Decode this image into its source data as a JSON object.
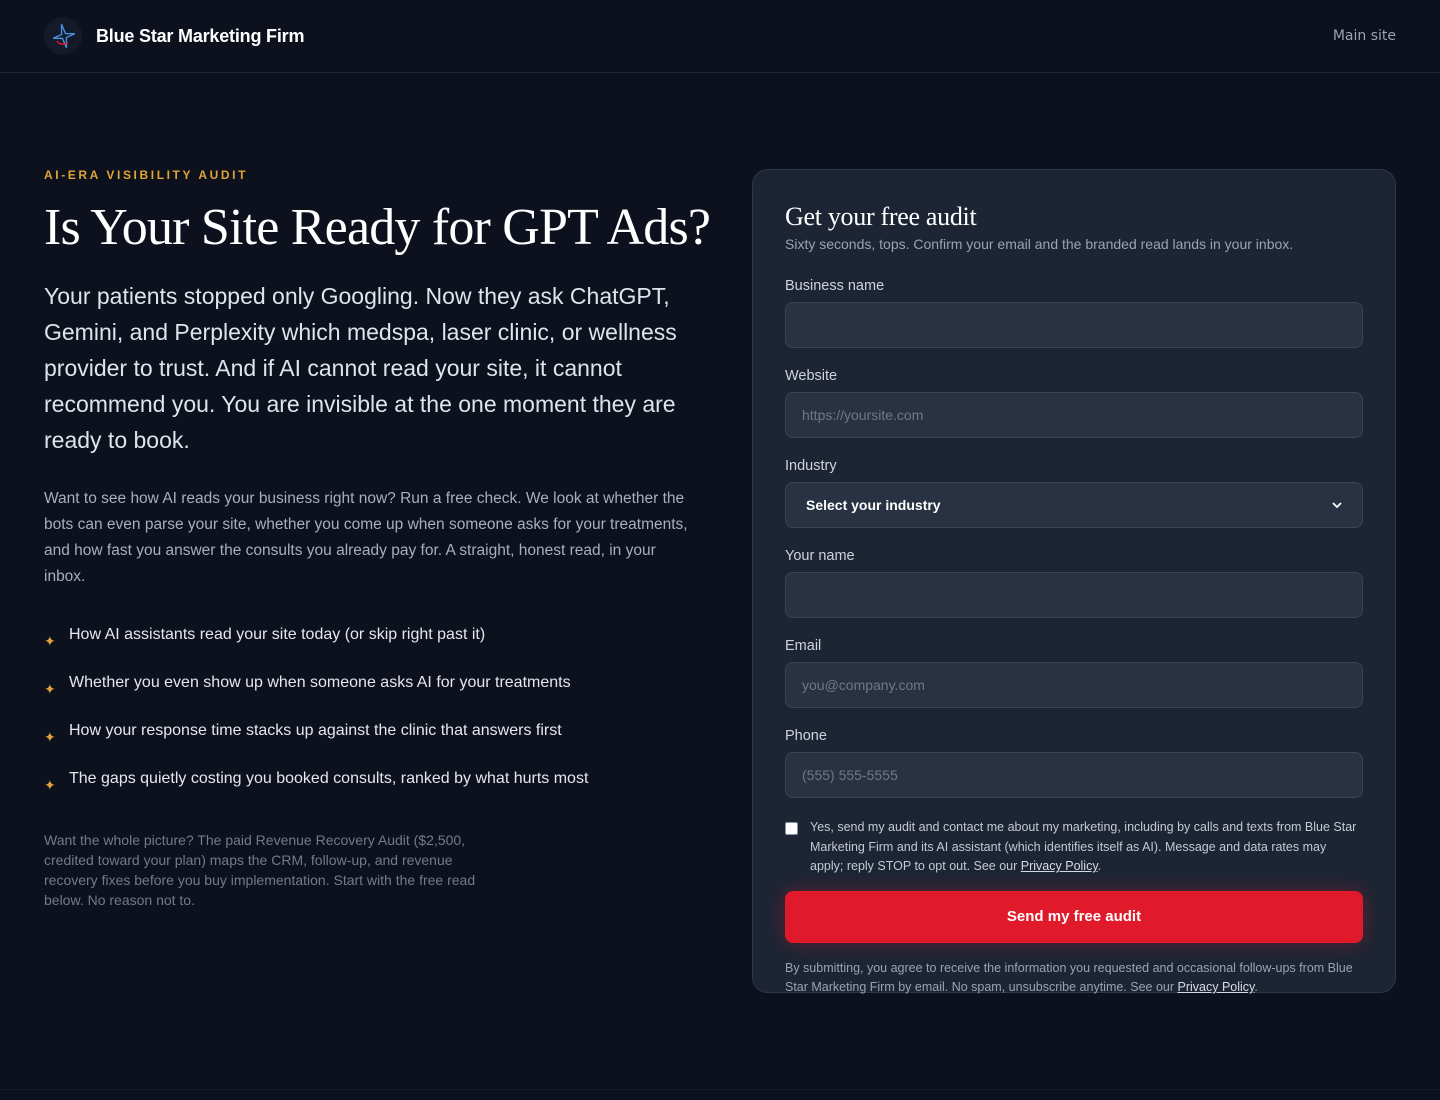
{
  "header": {
    "brand_name": "Blue Star Marketing Firm",
    "logo_icon": "blue-star-logo",
    "main_link": "Main site"
  },
  "hero": {
    "eyebrow": "AI-ERA VISIBILITY AUDIT",
    "title": "Is Your Site Ready for GPT Ads?",
    "lead": "Your patients stopped only Googling. Now they ask ChatGPT, Gemini, and Perplexity which medspa, laser clinic, or wellness provider to trust. And if AI cannot read your site, it cannot recommend you. You are invisible at the one moment they are ready to book.",
    "body": "Want to see how AI reads your business right now? Run a free check. We look at whether the bots can even parse your site, whether you come up when someone asks for your treatments, and how fast you answer the consults you already pay for. A straight, honest read, in your inbox.",
    "bullet_icon": "sparkle-icon",
    "bullets": [
      "How AI assistants read your site today (or skip right past it)",
      "Whether you even show up when someone asks AI for your treatments",
      "How your response time stacks up against the clinic that answers first",
      "The gaps quietly costing you booked consults, ranked by what hurts most"
    ],
    "footnote": "Want the whole picture? The paid Revenue Recovery Audit ($2,500, credited toward your plan) maps the CRM, follow-up, and revenue recovery fixes before you buy implementation. Start with the free read below. No reason not to."
  },
  "form": {
    "title": "Get your free audit",
    "subtitle": "Sixty seconds, tops. Confirm your email and the branded read lands in your inbox.",
    "business_name": {
      "label": "Business name",
      "value": "",
      "placeholder": ""
    },
    "website": {
      "label": "Website",
      "value": "",
      "placeholder": "https://yoursite.com"
    },
    "industry": {
      "label": "Industry",
      "selected": "Select your industry"
    },
    "your_name": {
      "label": "Your name",
      "value": "",
      "placeholder": ""
    },
    "email": {
      "label": "Email",
      "value": "",
      "placeholder": "you@company.com"
    },
    "phone": {
      "label": "Phone",
      "value": "",
      "placeholder": "(555) 555-5555"
    },
    "consent": {
      "checked": false,
      "text": "Yes, send my audit and contact me about my marketing, including by calls and texts from Blue Star Marketing Firm and its AI assistant (which identifies itself as AI). Message and data rates may apply; reply STOP to opt out. See our ",
      "link": "Privacy Policy",
      "end": "."
    },
    "submit_label": "Send my free audit",
    "legal": {
      "text": "By submitting, you agree to receive the information you requested and occasional follow-ups from Blue Star Marketing Firm by email. No spam, unsubscribe anytime. See our ",
      "link": "Privacy Policy",
      "end": "."
    }
  },
  "colors": {
    "background": "#0c111d",
    "card": "#1d2534",
    "accent_gold": "#e0a536",
    "button_red": "#e0192b"
  }
}
